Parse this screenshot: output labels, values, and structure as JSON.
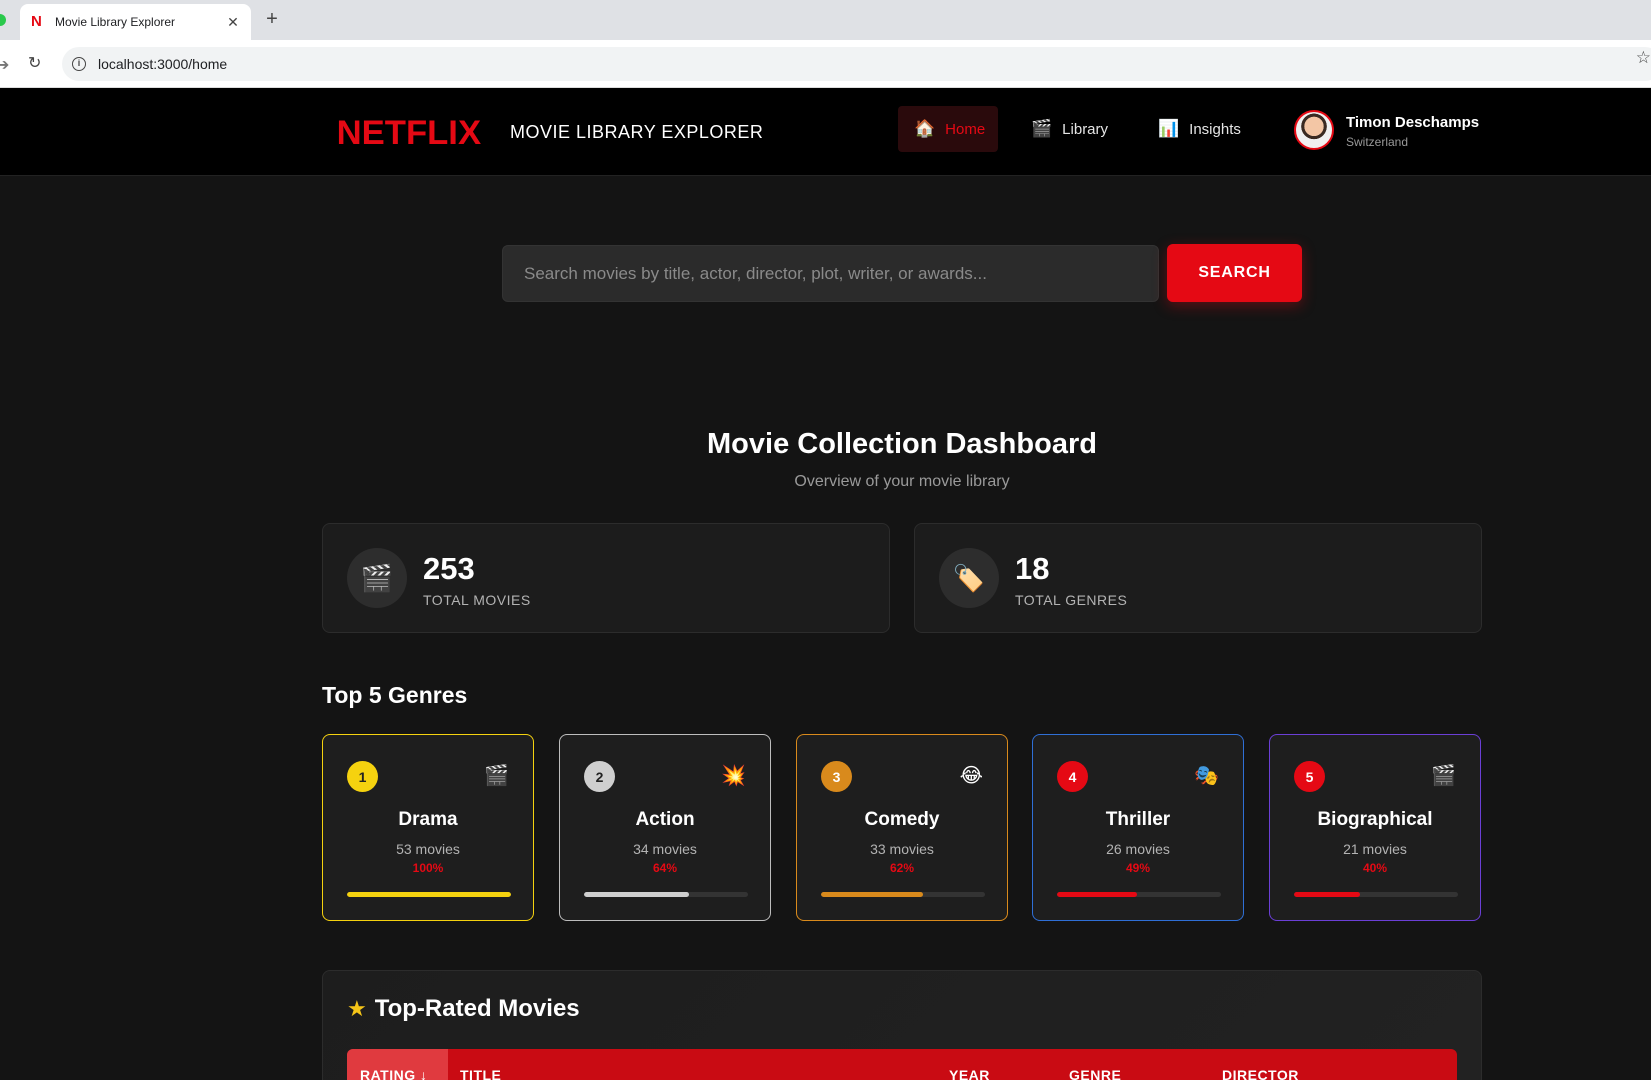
{
  "browser": {
    "tab_title": "Movie Library Explorer",
    "url": "localhost:3000/home"
  },
  "header": {
    "logo": "NETFLIX",
    "title": "MOVIE LIBRARY EXPLORER",
    "nav": [
      {
        "label": "Home",
        "icon": "house-icon",
        "active": true
      },
      {
        "label": "Library",
        "icon": "clapperboard-icon",
        "active": false
      },
      {
        "label": "Insights",
        "icon": "bar-chart-icon",
        "active": false
      }
    ],
    "user": {
      "name": "Timon Deschamps",
      "location": "Switzerland"
    }
  },
  "search": {
    "placeholder": "Search movies by title, actor, director, plot, writer, or awards...",
    "button_label": "SEARCH"
  },
  "dashboard": {
    "title": "Movie Collection Dashboard",
    "subtitle": "Overview of your movie library",
    "stats": [
      {
        "value": "253",
        "label": "TOTAL MOVIES",
        "icon": "clapperboard-icon"
      },
      {
        "value": "18",
        "label": "TOTAL GENRES",
        "icon": "tag-icon"
      }
    ]
  },
  "top_genres": {
    "title": "Top 5 Genres",
    "items": [
      {
        "rank": "1",
        "name": "Drama",
        "count": "53 movies",
        "percent": "100%",
        "fraction": 1.0,
        "icon": "clapperboard-icon",
        "color": "#f5d20f"
      },
      {
        "rank": "2",
        "name": "Action",
        "count": "34 movies",
        "percent": "64%",
        "fraction": 0.64,
        "icon": "explosion-icon",
        "color": "#cfcfcf"
      },
      {
        "rank": "3",
        "name": "Comedy",
        "count": "33 movies",
        "percent": "62%",
        "fraction": 0.62,
        "icon": "laughing-face-icon",
        "color": "#d98a1c"
      },
      {
        "rank": "4",
        "name": "Thriller",
        "count": "26 movies",
        "percent": "49%",
        "fraction": 0.49,
        "icon": "theater-masks-icon",
        "color": "#e50914"
      },
      {
        "rank": "5",
        "name": "Biographical",
        "count": "21 movies",
        "percent": "40%",
        "fraction": 0.4,
        "icon": "clapperboard-icon",
        "color": "#e50914"
      }
    ]
  },
  "top_rated": {
    "title": "Top-Rated Movies",
    "columns": [
      "RATING ↓",
      "TITLE",
      "YEAR",
      "GENRE",
      "DIRECTOR"
    ]
  }
}
